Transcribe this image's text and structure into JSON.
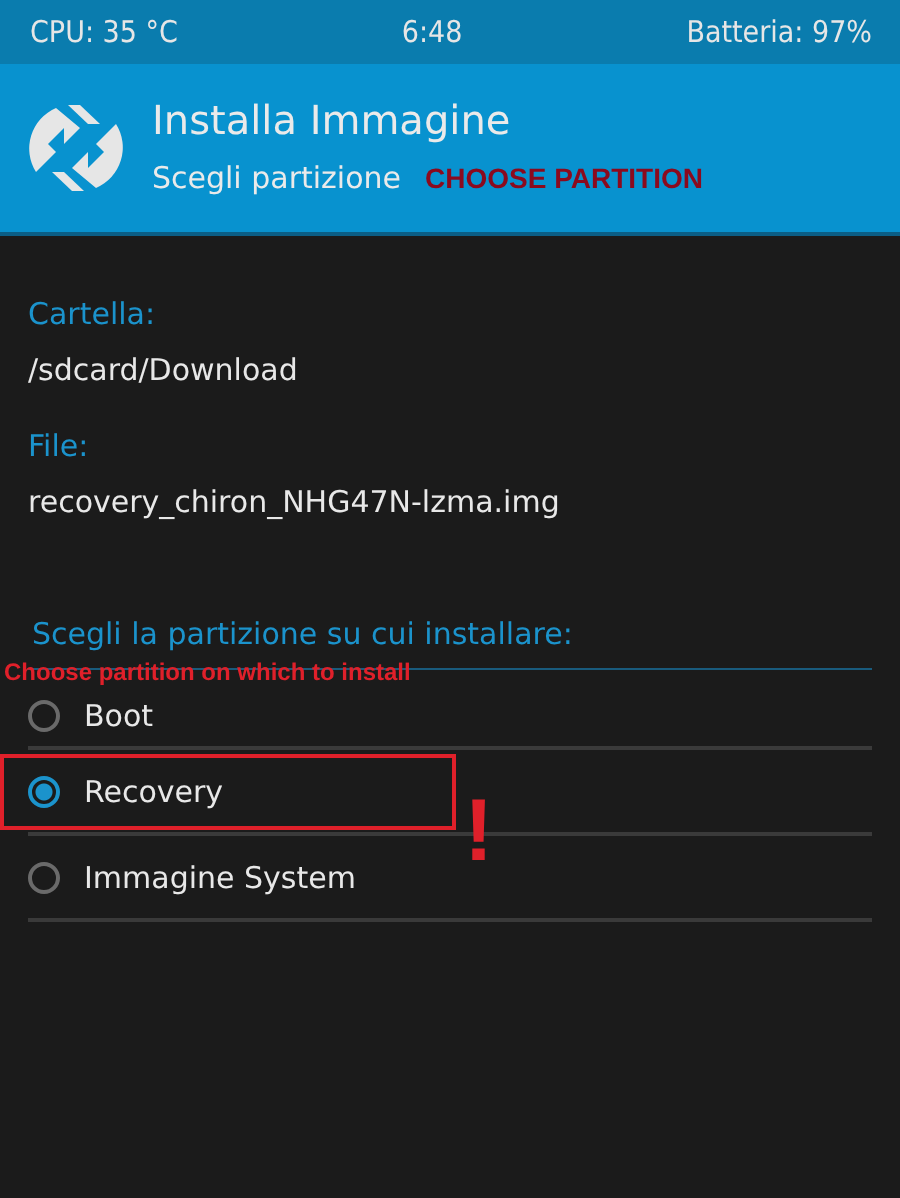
{
  "status_bar": {
    "cpu": "CPU: 35 °C",
    "time": "6:48",
    "battery": "Batteria: 97%"
  },
  "header": {
    "title": "Installa Immagine",
    "subtitle": "Scegli partizione",
    "annotation": "CHOOSE PARTITION"
  },
  "fields": [
    {
      "label": "Cartella:",
      "value": "/sdcard/Download"
    },
    {
      "label": "File:",
      "value": "recovery_chiron_NHG47N-lzma.img"
    }
  ],
  "partitions": {
    "label": "Scegli la partizione su cui installare:",
    "annotation": "Choose partition on which to install",
    "mark": "!",
    "options": [
      {
        "label": "Boot",
        "selected": false,
        "highlighted": false
      },
      {
        "label": "Recovery",
        "selected": true,
        "highlighted": true
      },
      {
        "label": "Immagine System",
        "selected": false,
        "highlighted": false
      }
    ]
  }
}
